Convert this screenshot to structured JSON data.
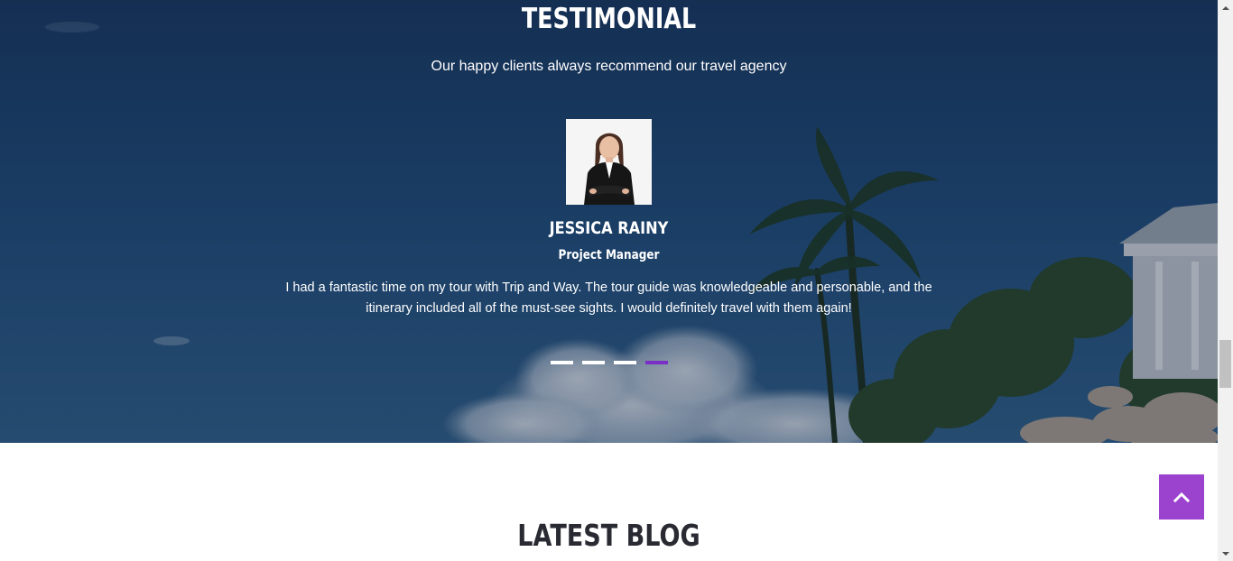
{
  "testimonial": {
    "title": "TESTIMONIAL",
    "subtitle": "Our happy clients always recommend our travel agency",
    "name": "JESSICA RAINY",
    "role": "Project Manager",
    "quote": "I had a fantastic time on my tour with Trip and Way. The tour guide was knowledgeable and personable, and the itinerary included all of the must-see sights. I would definitely travel with them again!",
    "slides": 4,
    "active_slide": 4
  },
  "blog": {
    "title": "LATEST BLOG"
  },
  "icons": {
    "back_to_top": "chevron-up-icon",
    "avatar": "person-avatar-icon"
  },
  "colors": {
    "accent": "#9b42cf",
    "active_dot": "#7a2fc7",
    "heading_dark": "#2a2a33"
  }
}
